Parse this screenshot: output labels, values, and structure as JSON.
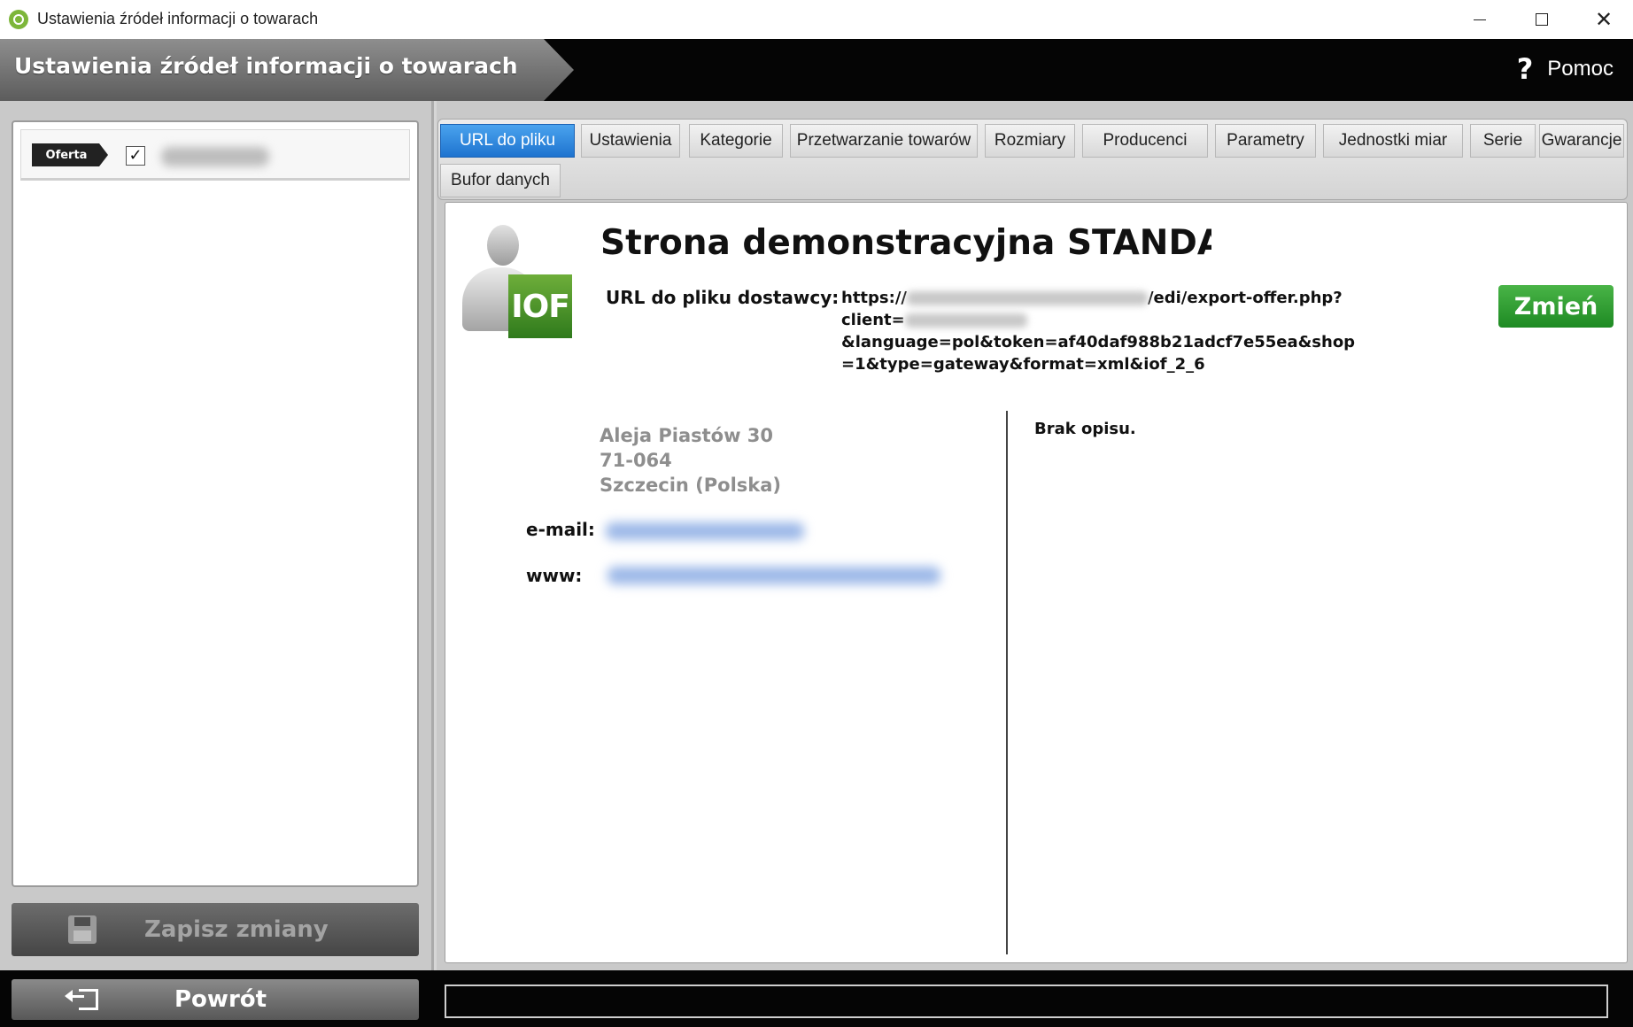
{
  "window": {
    "title": "Ustawienia źródeł informacji o towarach"
  },
  "header": {
    "title": "Ustawienia źródeł informacji o towarach",
    "help_label": "Pomoc",
    "help_icon": "?"
  },
  "left_panel": {
    "items": [
      {
        "tag": "Oferta",
        "checked": true,
        "check_glyph": "✓"
      }
    ],
    "save_label": "Zapisz zmiany"
  },
  "tabs": [
    {
      "label": "URL do pliku",
      "active": true
    },
    {
      "label": "Ustawienia",
      "active": false
    },
    {
      "label": "Kategorie",
      "active": false
    },
    {
      "label": "Przetwarzanie towarów",
      "active": false
    },
    {
      "label": "Rozmiary",
      "active": false
    },
    {
      "label": "Producenci",
      "active": false
    },
    {
      "label": "Parametry",
      "active": false
    },
    {
      "label": "Jednostki miar",
      "active": false
    },
    {
      "label": "Serie",
      "active": false
    },
    {
      "label": "Gwarancje",
      "active": false
    },
    {
      "label": "Bufor danych",
      "active": false
    }
  ],
  "source": {
    "badge_text": "IOF",
    "title": "Strona demonstracyjna STANDARD",
    "url_label": "URL do pliku dostawcy:",
    "url_part1": "https://",
    "url_part2": "/edi/export-offer.php?",
    "url_part3": "client=",
    "url_part4": "&language=pol&token=af40daf988b21adcf7e55ea&shop",
    "url_part5": "=1&type=gateway&format=xml&iof_2_6",
    "change_label": "Zmień",
    "address": {
      "street": "Aleja Piastów 30",
      "postal": "71-064",
      "city": "Szczecin (Polska)"
    },
    "email_label": "e-mail:",
    "www_label": "www:",
    "description": "Brak opisu."
  },
  "footer": {
    "back_label": "Powrót"
  },
  "colors": {
    "active_tab": "#2a86e0",
    "change_button": "#2f9a2f",
    "header_bg": "#050505"
  }
}
